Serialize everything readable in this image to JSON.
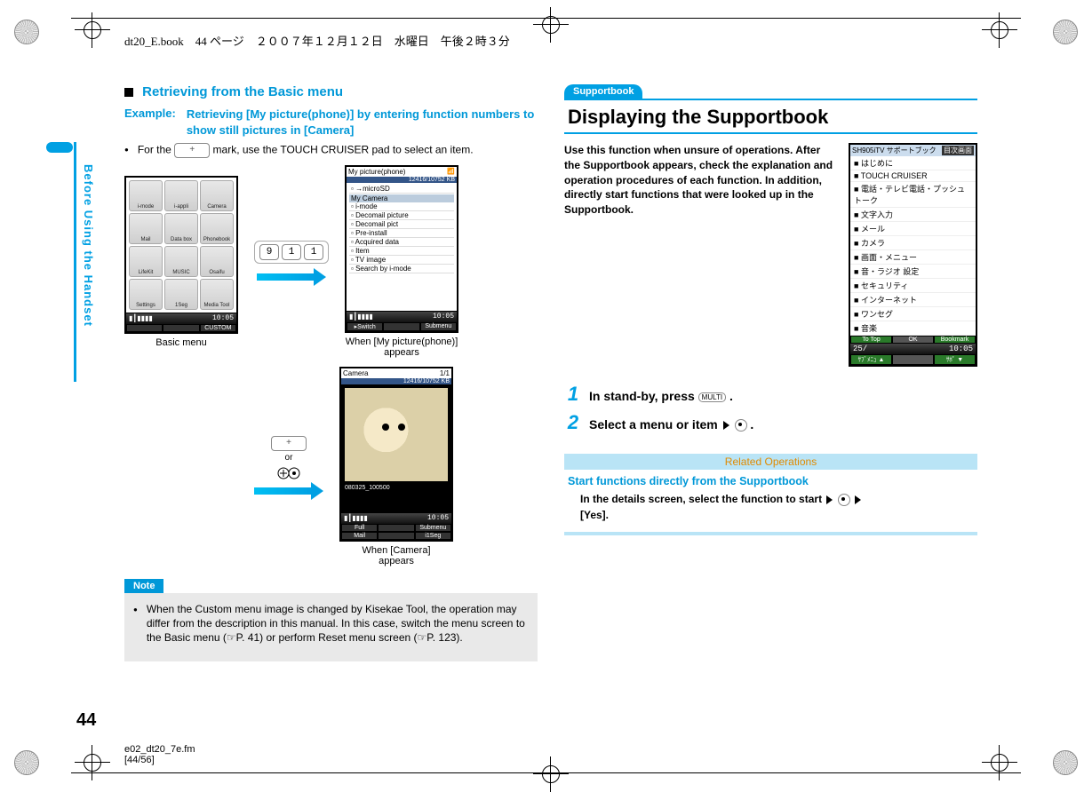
{
  "header": {
    "filetag": "dt20_E.book　44 ページ　２００７年１２月１２日　水曜日　午後２時３分"
  },
  "sideTab": "Before Using the Handset",
  "leftCol": {
    "heading": "Retrieving from the Basic menu",
    "exampleLabel": "Example:",
    "exampleText": "Retrieving [My picture(phone)] by entering function numbers to show still pictures in [Camera]",
    "forThePrefix": "For the ",
    "forTheSuffix": " mark, use the TOUCH CRUISER pad to select an item.",
    "keys911": [
      "9",
      "1",
      "1"
    ],
    "basicMenuCells": [
      "i-mode",
      "i-appli",
      "Camera",
      "Mail",
      "Data box",
      "Phonebook",
      "LifeKit",
      "MUSIC",
      "Osaifu",
      "Settings",
      "1Seg",
      "Media Tool"
    ],
    "basicMenuSoftkeys": [
      "",
      "",
      "CUSTOM"
    ],
    "basicMenuStatusLeft": "▮┃▮▮▮▮",
    "basicMenuStatusRight": "10:05",
    "basicMenuCaption": "Basic menu",
    "myPicTitle": "My picture(phone)",
    "myPicSub": "12416/10752 KB",
    "myPicSection1": "→microSD",
    "myPicSection2": "My Camera",
    "myPicItems": [
      "i-mode",
      "Decomail picture",
      "Decomail pict",
      "Pre-install",
      "Acquired data",
      "Item",
      "TV image",
      "Search by i-mode"
    ],
    "myPicSoft": [
      "▸Switch",
      "",
      "Submenu"
    ],
    "myPicCaption1": "When [My picture(phone)]",
    "myPicCaption2": "appears",
    "orLabel": "or",
    "cameraTitle": "Camera",
    "cameraSub": "1/1",
    "cameraBand": "12416/10752 KB",
    "cameraFile": "080325_100500",
    "cameraSoft": [
      "Full",
      "",
      "Submenu"
    ],
    "cameraSoft2": [
      "Mail",
      "",
      "i1Seg"
    ],
    "cameraCaption1": "When [Camera]",
    "cameraCaption2": "appears",
    "noteLabel": "Note",
    "noteText": "When the Custom menu image is changed by Kisekae Tool, the operation may differ from the description in this manual. In this case, switch the menu screen to the Basic menu (☞P. 41) or perform Reset menu screen (☞P. 123)."
  },
  "rightCol": {
    "secLabel": "Supportbook",
    "secTitle": "Displaying the Supportbook",
    "intro": "Use this function when unsure of operations. After the Supportbook appears, check the explanation and operation procedures of each function. In addition, directly start functions that were looked up in the Supportbook.",
    "suppTop1": "SH905iTV サポートブック",
    "suppTop2": "目次画面",
    "suppItems": [
      "はじめに",
      "TOUCH CRUISER",
      "電話・テレビ電話・プッシュトーク",
      "文字入力",
      "メール",
      "カメラ",
      "画面・メニュー",
      "音・ラジオ 設定",
      "セキュリティ",
      "インターネット",
      "ワンセグ",
      "音楽"
    ],
    "suppSoft": [
      "To Top",
      "OK",
      "Bookmark"
    ],
    "suppSoft2": [
      "ｻﾌﾞﾒﾆｭ ▲",
      "",
      "ｻﾎﾟ ▼"
    ],
    "suppStatusLeft": "25/",
    "suppStatusRight": "10:05",
    "step1": "In stand-by, press ",
    "step1end": ".",
    "step2a": "Select a menu or item",
    "step2b": ".",
    "relOpsHeader": "Related Operations",
    "relOpsSub": "Start functions directly from the Supportbook",
    "relOpsLine1": "In the details screen, select the function to start",
    "relOpsLine2": "[Yes]."
  },
  "pageNumber": "44",
  "footer1": "e02_dt20_7e.fm",
  "footer2": "[44/56]"
}
